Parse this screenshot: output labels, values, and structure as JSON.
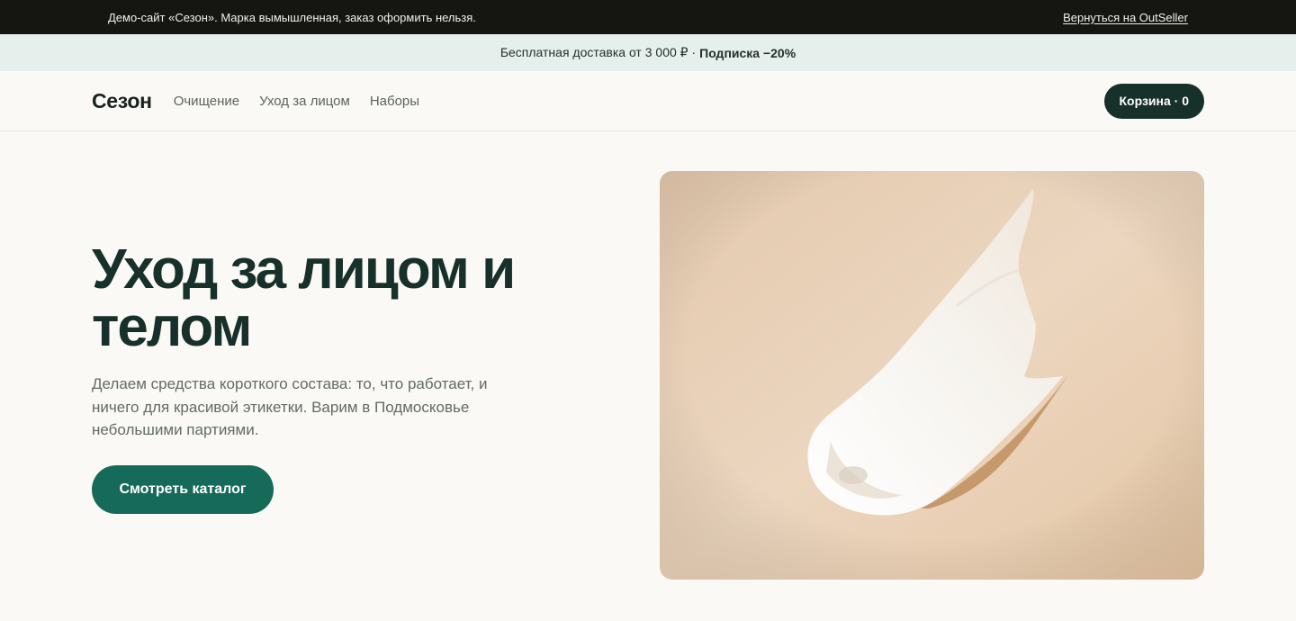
{
  "demo_bar": {
    "notice": "Демо-сайт «Сезон». Марка вымышленная, заказ оформить нельзя.",
    "back_link": "Вернуться на OutSeller"
  },
  "promo_bar": {
    "text": "Бесплатная доставка от 3 000 ₽ ·",
    "highlight": "Подписка −20%"
  },
  "header": {
    "logo": "Сезон",
    "nav": [
      {
        "label": "Очищение"
      },
      {
        "label": "Уход за лицом"
      },
      {
        "label": "Наборы"
      }
    ],
    "cart_label": "Корзина · 0"
  },
  "hero": {
    "title_line1": "Уход за лицом и",
    "title_line2": "телом",
    "subtitle": "Делаем средства короткого состава: то, что работает, и ничего для красивой этикетки. Варим в Подмосковье небольшими партиями.",
    "cta_label": "Смотреть каталог",
    "image_icon": "cream-swatch-photo"
  },
  "colors": {
    "demo_bar_bg": "#151611",
    "promo_bar_bg": "#e6efeb",
    "page_bg": "#faf9f6",
    "heading": "#17302a",
    "cart_button": "#17302a",
    "cta_button": "#166a59",
    "image_bg": "#e8cfb4"
  }
}
